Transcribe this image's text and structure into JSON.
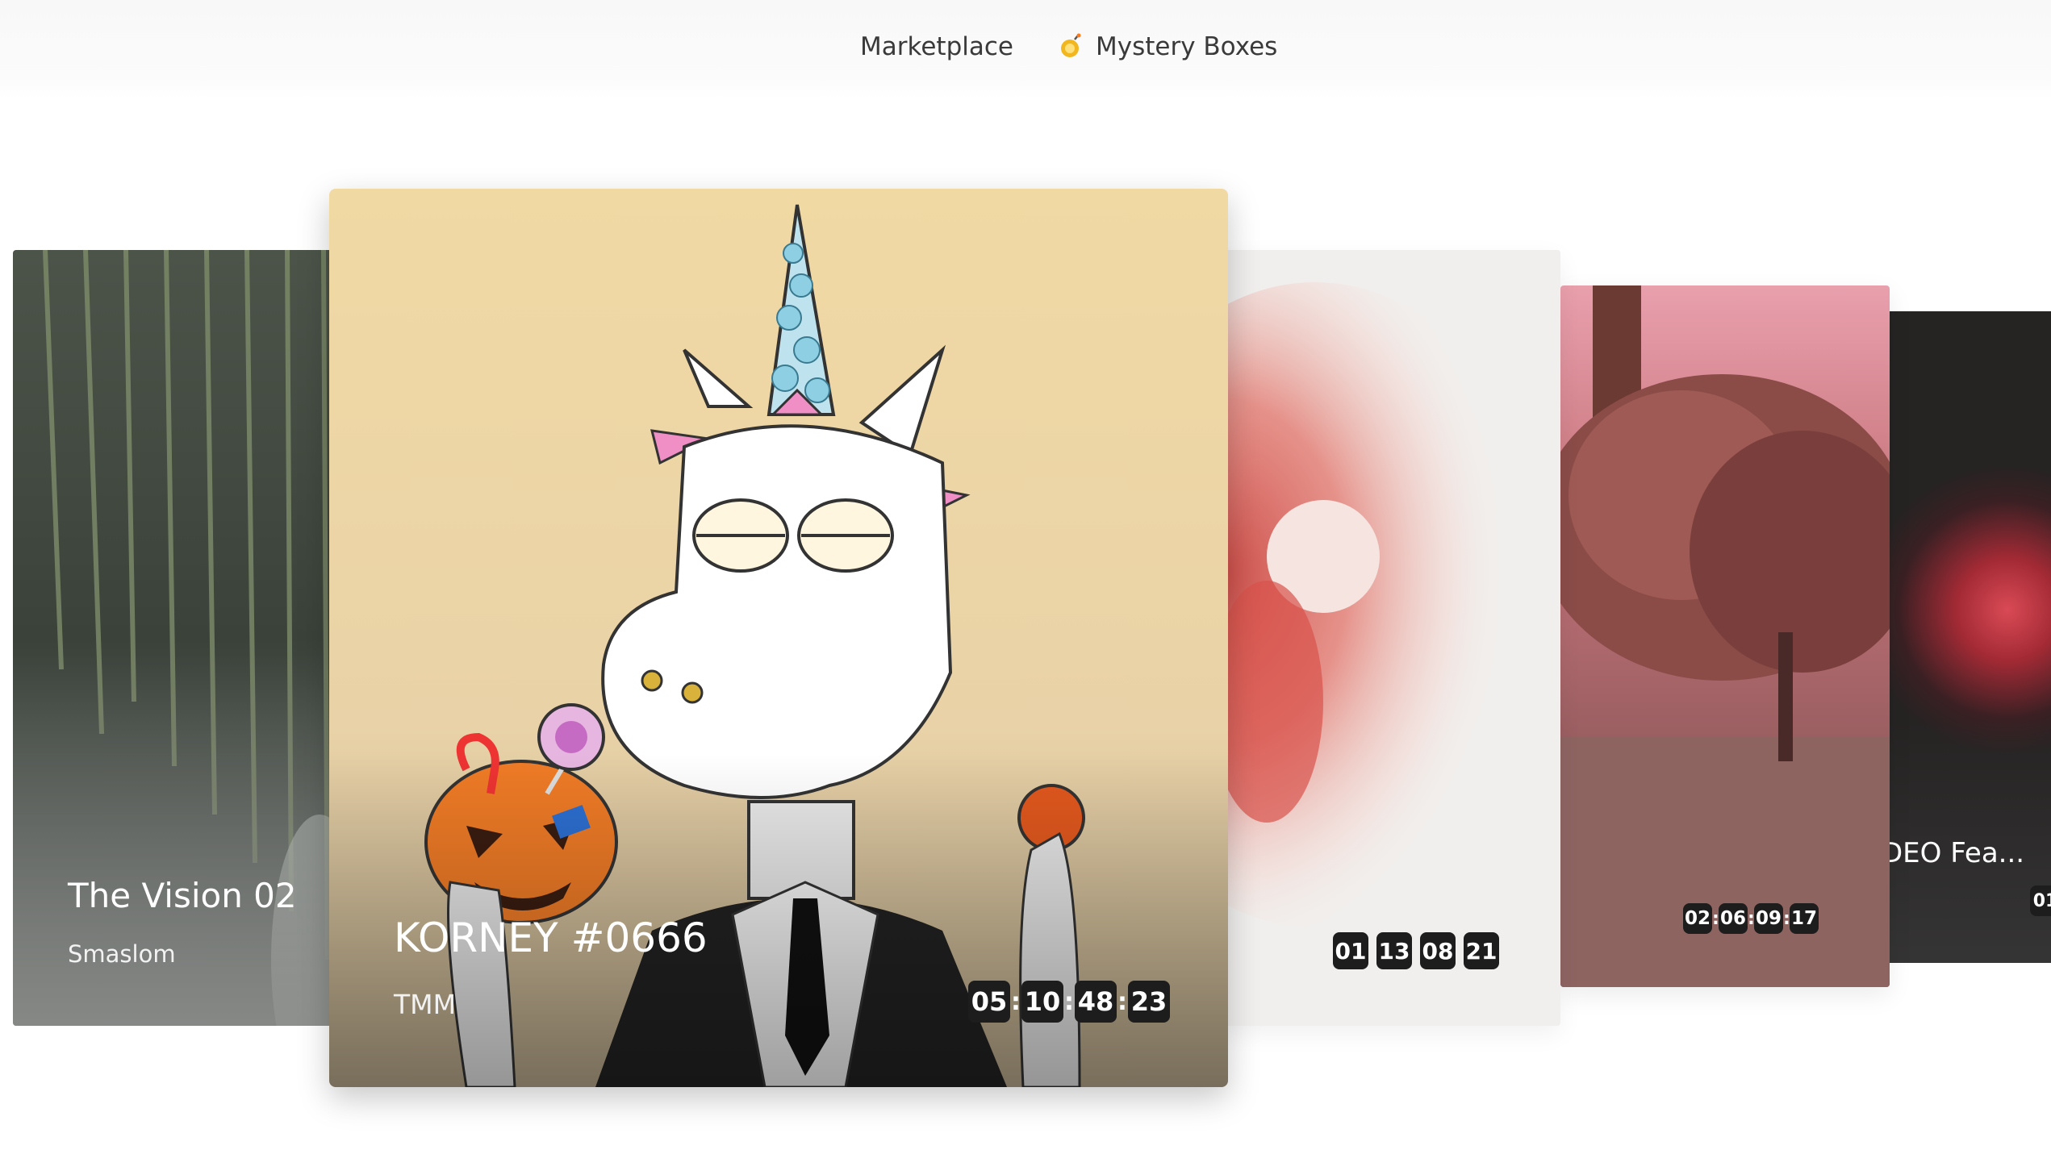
{
  "nav": {
    "marketplace": "Marketplace",
    "mystery_boxes": "Mystery Boxes",
    "mystery_icon": "bomb-icon"
  },
  "cards": [
    {
      "title": "The Vision 02",
      "creator": "Smaslom",
      "image": "willow-tree-forest-night"
    },
    {
      "title": "KORNEY #0666",
      "creator": "TMM",
      "image": "unicorn-cartoon-halloween",
      "timer": [
        "05",
        "10",
        "48",
        "23"
      ]
    },
    {
      "image": "red-ink-abstract",
      "timer": [
        "01",
        "13",
        "08",
        "21"
      ]
    },
    {
      "image": "pink-tree-ruins",
      "timer": [
        "02",
        "06",
        "09",
        "17"
      ]
    },
    {
      "title": "DEO Fea...",
      "image": "dark-red-glow",
      "timer_partial": "01"
    }
  ]
}
